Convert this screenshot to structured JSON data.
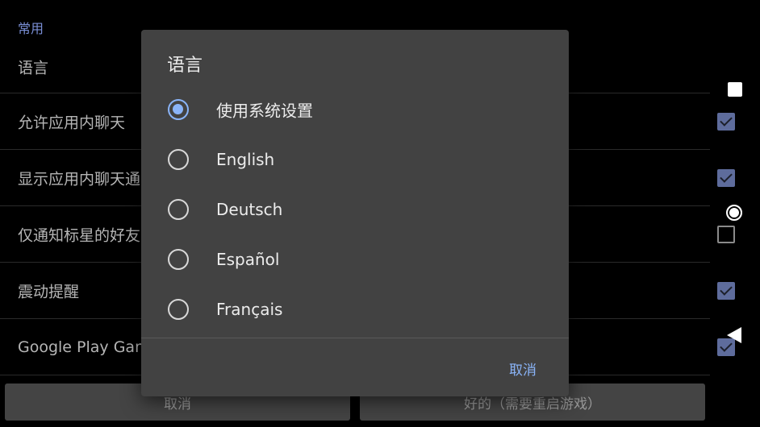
{
  "settings": {
    "section_header": "常用",
    "rows": [
      {
        "label": "语言",
        "checked": null
      },
      {
        "label": "允许应用内聊天",
        "checked": true
      },
      {
        "label": "显示应用内聊天通",
        "checked": true
      },
      {
        "label": "仅通知标星的好友",
        "checked": false
      },
      {
        "label": "震动提醒",
        "checked": true
      },
      {
        "label": "Google Play Gam",
        "checked": true
      }
    ],
    "bottom_buttons": {
      "cancel": "取消",
      "ok": "好的（需要重启游戏）"
    }
  },
  "dialog": {
    "title": "语言",
    "options": [
      {
        "label": "使用系统设置",
        "selected": true
      },
      {
        "label": "English",
        "selected": false
      },
      {
        "label": "Deutsch",
        "selected": false
      },
      {
        "label": "Español",
        "selected": false
      },
      {
        "label": "Français",
        "selected": false
      }
    ],
    "cancel_label": "取消"
  },
  "colors": {
    "accent": "#8ab4f8",
    "dialog_bg": "#424242",
    "section_header": "#7a8fd6"
  },
  "nav_icons": [
    "square-icon",
    "circle-icon",
    "back-triangle-icon"
  ]
}
